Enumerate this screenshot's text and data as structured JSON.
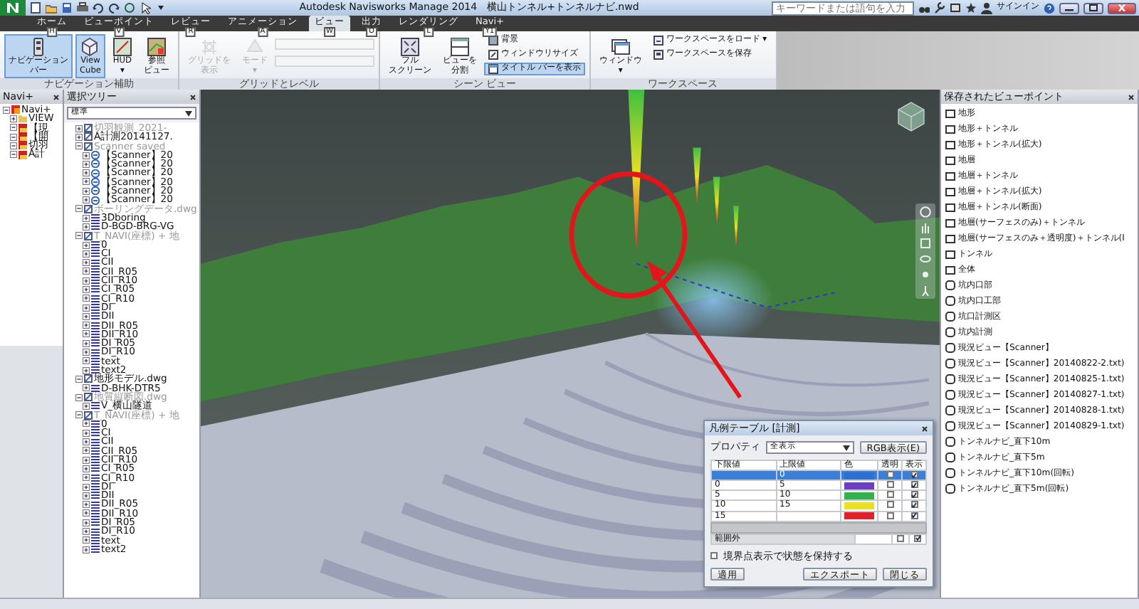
{
  "title_bar": {
    "title": "Autodesk Navisworks Manage 2014　横山トンネル+トンネルナビ.nwd",
    "search": {
      "placeholder": "キーワードまたは語句を入力"
    },
    "sign_in": "サインイン"
  },
  "ribbon_tabs": [
    {
      "label": "ホーム",
      "keytip": "H",
      "selected": false
    },
    {
      "label": "ビューポイント",
      "keytip": "V",
      "selected": false
    },
    {
      "label": "レビュー",
      "keytip": "R",
      "selected": false
    },
    {
      "label": "アニメーション",
      "keytip": "A",
      "selected": false
    },
    {
      "label": "ビュー",
      "keytip": "W",
      "selected": true
    },
    {
      "label": "出力",
      "keytip": "O",
      "selected": false
    },
    {
      "label": "レンダリング",
      "keytip": "L",
      "selected": false
    },
    {
      "label": "Navi+",
      "keytip": "Y1",
      "selected": false
    }
  ],
  "ribbon_groups": [
    {
      "title": "ナビゲーション補助",
      "items": [
        {
          "kind": "large",
          "lines": [
            "ナビゲーション",
            "バー"
          ],
          "selected": true,
          "disabled": false
        },
        {
          "kind": "large",
          "lines": [
            "View",
            "Cube"
          ],
          "selected": true,
          "disabled": false
        },
        {
          "kind": "large",
          "lines": [
            "HUD",
            "▾"
          ],
          "selected": false,
          "disabled": false
        },
        {
          "kind": "large",
          "lines": [
            "参照",
            "ビュー"
          ],
          "selected": false,
          "disabled": false
        }
      ]
    },
    {
      "title": "グリッドとレベル",
      "items": [
        {
          "kind": "large",
          "lines": [
            "グリッドを",
            "表示"
          ],
          "selected": false,
          "disabled": true
        },
        {
          "kind": "large",
          "lines": [
            "モード",
            "▾"
          ],
          "selected": false,
          "disabled": true
        },
        {
          "kind": "combo",
          "disabled": true
        },
        {
          "kind": "combo",
          "disabled": true
        }
      ]
    },
    {
      "title": "シーン ビュー",
      "items": [
        {
          "kind": "large",
          "lines": [
            "フル",
            "スクリーン"
          ],
          "selected": false,
          "disabled": false
        },
        {
          "kind": "large",
          "lines": [
            "ビューを",
            "分割"
          ],
          "selected": false,
          "disabled": false
        },
        {
          "kind": "small",
          "lines": [
            "背景"
          ],
          "selected": false,
          "disabled": false
        },
        {
          "kind": "small",
          "lines": [
            "ウィンドウリサイズ"
          ],
          "selected": false,
          "disabled": false
        },
        {
          "kind": "small",
          "lines": [
            "タイトル バーを表示"
          ],
          "selected": true,
          "disabled": false
        }
      ]
    },
    {
      "title": "ワークスペース",
      "items": [
        {
          "kind": "large",
          "lines": [
            "ウィンドウ",
            "▾"
          ],
          "selected": false,
          "disabled": false
        },
        {
          "kind": "small",
          "lines": [
            "ワークスペースをロード ▾"
          ],
          "selected": false,
          "disabled": false
        },
        {
          "kind": "small",
          "lines": [
            "ワークスペースを保存"
          ],
          "selected": false,
          "disabled": false
        }
      ]
    }
  ],
  "navi_panel": {
    "title": "Navi+",
    "tree": [
      {
        "label": "Navi+",
        "kind": "root",
        "expanded": true,
        "children": [
          {
            "label": "VIEW",
            "kind": "folder",
            "expanded": false
          },
          {
            "label": "【現",
            "kind": "group",
            "expanded": true
          },
          {
            "label": "【開",
            "kind": "group",
            "expanded": true
          },
          {
            "label": "切羽",
            "kind": "group",
            "expanded": true
          },
          {
            "label": "A計",
            "kind": "group",
            "expanded": true
          }
        ]
      }
    ]
  },
  "selection_tree": {
    "title": "選択ツリー",
    "mode": "標準",
    "items": [
      {
        "label": "切羽観測_2021-",
        "kind": "file",
        "hidden": true,
        "expanded": false
      },
      {
        "label": "A計測20141127.",
        "kind": "file",
        "hidden": false,
        "expanded": false
      },
      {
        "label": "Scanner saved",
        "kind": "file",
        "hidden": true,
        "expanded": true,
        "children": [
          {
            "label": "【Scanner】20",
            "kind": "scanner",
            "hidden": false,
            "expanded": false
          },
          {
            "label": "【Scanner】20",
            "kind": "scanner",
            "hidden": false,
            "expanded": false
          },
          {
            "label": "【Scanner】20",
            "kind": "scanner",
            "hidden": false,
            "expanded": false
          },
          {
            "label": "【Scanner】20",
            "kind": "scanner",
            "hidden": false,
            "expanded": false
          },
          {
            "label": "【Scanner】20",
            "kind": "scanner",
            "hidden": false,
            "expanded": false
          },
          {
            "label": "【Scanner】20",
            "kind": "scanner",
            "hidden": false,
            "expanded": false
          }
        ]
      },
      {
        "label": "ボーリングデータ.dwg",
        "kind": "file",
        "hidden": true,
        "expanded": true,
        "children": [
          {
            "label": "3Dboring",
            "kind": "layer",
            "hidden": false,
            "expanded": false
          },
          {
            "label": "D-BGD-BRG-VG",
            "kind": "layer",
            "hidden": false,
            "expanded": false
          }
        ]
      },
      {
        "label": "T_NAVI(座標) + 地",
        "kind": "file",
        "hidden": true,
        "expanded": true,
        "children": [
          {
            "label": "0",
            "kind": "layer",
            "hidden": false,
            "expanded": false
          },
          {
            "label": "CI",
            "kind": "layer",
            "hidden": false,
            "expanded": false
          },
          {
            "label": "CII",
            "kind": "layer",
            "hidden": false,
            "expanded": false
          },
          {
            "label": "CII_R05",
            "kind": "layer",
            "hidden": false,
            "expanded": false
          },
          {
            "label": "CII_R10",
            "kind": "layer",
            "hidden": false,
            "expanded": false
          },
          {
            "label": "CI_R05",
            "kind": "layer",
            "hidden": false,
            "expanded": false
          },
          {
            "label": "CI_R10",
            "kind": "layer",
            "hidden": false,
            "expanded": false
          },
          {
            "label": "DI",
            "kind": "layer",
            "hidden": false,
            "expanded": false
          },
          {
            "label": "DII",
            "kind": "layer",
            "hidden": false,
            "expanded": false
          },
          {
            "label": "DII_R05",
            "kind": "layer",
            "hidden": false,
            "expanded": false
          },
          {
            "label": "DII_R10",
            "kind": "layer",
            "hidden": false,
            "expanded": false
          },
          {
            "label": "DI_R05",
            "kind": "layer",
            "hidden": false,
            "expanded": false
          },
          {
            "label": "DI_R10",
            "kind": "layer",
            "hidden": false,
            "expanded": false
          },
          {
            "label": "text",
            "kind": "layer",
            "hidden": false,
            "expanded": false
          },
          {
            "label": "text2",
            "kind": "layer",
            "hidden": false,
            "expanded": false
          }
        ]
      },
      {
        "label": "地形モデル.dwg",
        "kind": "file",
        "hidden": false,
        "expanded": true,
        "children": [
          {
            "label": "D-BHK-DTR5",
            "kind": "layer",
            "hidden": false,
            "expanded": false
          }
        ]
      },
      {
        "label": "地質縦断図.dwg",
        "kind": "file",
        "hidden": true,
        "expanded": true,
        "children": [
          {
            "label": "V_横山隧道",
            "kind": "layer",
            "hidden": false,
            "expanded": false
          }
        ]
      },
      {
        "label": "T_NAVI(座標) + 地",
        "kind": "file",
        "hidden": true,
        "expanded": true,
        "children": [
          {
            "label": "0",
            "kind": "layer",
            "hidden": false,
            "expanded": false
          },
          {
            "label": "CI",
            "kind": "layer",
            "hidden": false,
            "expanded": false
          },
          {
            "label": "CII",
            "kind": "layer",
            "hidden": false,
            "expanded": false
          },
          {
            "label": "CII_R05",
            "kind": "layer",
            "hidden": false,
            "expanded": false
          },
          {
            "label": "CII_R10",
            "kind": "layer",
            "hidden": false,
            "expanded": false
          },
          {
            "label": "CI_R05",
            "kind": "layer",
            "hidden": false,
            "expanded": false
          },
          {
            "label": "CI_R10",
            "kind": "layer",
            "hidden": false,
            "expanded": false
          },
          {
            "label": "DI",
            "kind": "layer",
            "hidden": false,
            "expanded": false
          },
          {
            "label": "DII",
            "kind": "layer",
            "hidden": false,
            "expanded": false
          },
          {
            "label": "DII_R05",
            "kind": "layer",
            "hidden": false,
            "expanded": false
          },
          {
            "label": "DII_R10",
            "kind": "layer",
            "hidden": false,
            "expanded": false
          },
          {
            "label": "DI_R05",
            "kind": "layer",
            "hidden": false,
            "expanded": false
          },
          {
            "label": "DI_R10",
            "kind": "layer",
            "hidden": false,
            "expanded": false
          },
          {
            "label": "text",
            "kind": "layer",
            "hidden": false,
            "expanded": false
          },
          {
            "label": "text2",
            "kind": "layer",
            "hidden": false,
            "expanded": false
          }
        ]
      }
    ]
  },
  "viewpoints": {
    "title": "保存されたビューポイント",
    "items": [
      {
        "kind": "folder",
        "label": "地形"
      },
      {
        "kind": "folder",
        "label": "地形＋トンネル"
      },
      {
        "kind": "folder",
        "label": "地形＋トンネル(拡大)"
      },
      {
        "kind": "folder",
        "label": "地層"
      },
      {
        "kind": "folder",
        "label": "地層＋トンネル"
      },
      {
        "kind": "folder",
        "label": "地層＋トンネル(拡大)"
      },
      {
        "kind": "folder",
        "label": "地層＋トンネル(断面)"
      },
      {
        "kind": "folder",
        "label": "地層(サーフェスのみ)＋トンネル"
      },
      {
        "kind": "folder",
        "label": "地層(サーフェスのみ＋透明度)＋トンネル(I"
      },
      {
        "kind": "folder",
        "label": "トンネル"
      },
      {
        "kind": "folder",
        "label": "全体"
      },
      {
        "kind": "view",
        "label": "坑内口部"
      },
      {
        "kind": "view",
        "label": "坑内口工部"
      },
      {
        "kind": "view",
        "label": "坑口計測区"
      },
      {
        "kind": "view",
        "label": "坑内計測"
      },
      {
        "kind": "view",
        "label": "現況ビュー【Scanner】"
      },
      {
        "kind": "view",
        "label": "現況ビュー【Scanner】20140822-2.txt)"
      },
      {
        "kind": "view",
        "label": "現況ビュー【Scanner】20140825-1.txt)"
      },
      {
        "kind": "view",
        "label": "現況ビュー【Scanner】20140827-1.txt)"
      },
      {
        "kind": "view",
        "label": "現況ビュー【Scanner】20140828-1.txt)"
      },
      {
        "kind": "view",
        "label": "現況ビュー【Scanner】20140829-1.txt)"
      },
      {
        "kind": "view",
        "label": "トンネルナビ_直下10m"
      },
      {
        "kind": "view",
        "label": "トンネルナビ_直下5m"
      },
      {
        "kind": "view",
        "label": "トンネルナビ_直下10m(回転)"
      },
      {
        "kind": "view",
        "label": "トンネルナビ_直下5m(回転)"
      }
    ]
  },
  "legend_dialog": {
    "title": "凡例テーブル [計測]",
    "property_label": "プロパティ",
    "property_value": "全表示",
    "rgb_button": "RGB表示(E)",
    "columns": [
      "下限値",
      "上限値",
      "色",
      "透明",
      "表示"
    ],
    "rows": [
      {
        "lower": "",
        "upper": "0",
        "color": "#2f6fd0",
        "transparent": false,
        "visible": true,
        "selected": true
      },
      {
        "lower": "0",
        "upper": "5",
        "color": "#6a3fc0",
        "transparent": false,
        "visible": true,
        "selected": false
      },
      {
        "lower": "5",
        "upper": "10",
        "color": "#2fb34a",
        "transparent": false,
        "visible": true,
        "selected": false
      },
      {
        "lower": "10",
        "upper": "15",
        "color": "#e8e020",
        "transparent": false,
        "visible": true,
        "selected": false
      },
      {
        "lower": "15",
        "upper": "",
        "color": "#e0202a",
        "transparent": false,
        "visible": true,
        "selected": false
      }
    ],
    "out_of_range": {
      "label": "範囲外",
      "transparent": false,
      "visible": true
    },
    "keep_state": {
      "label": "境界点表示で状態を保持する",
      "checked": false
    },
    "buttons": [
      {
        "kind": "apply",
        "label": "適用"
      },
      {
        "kind": "export",
        "label": "エクスポート"
      },
      {
        "kind": "close",
        "label": "閉じる"
      }
    ]
  }
}
